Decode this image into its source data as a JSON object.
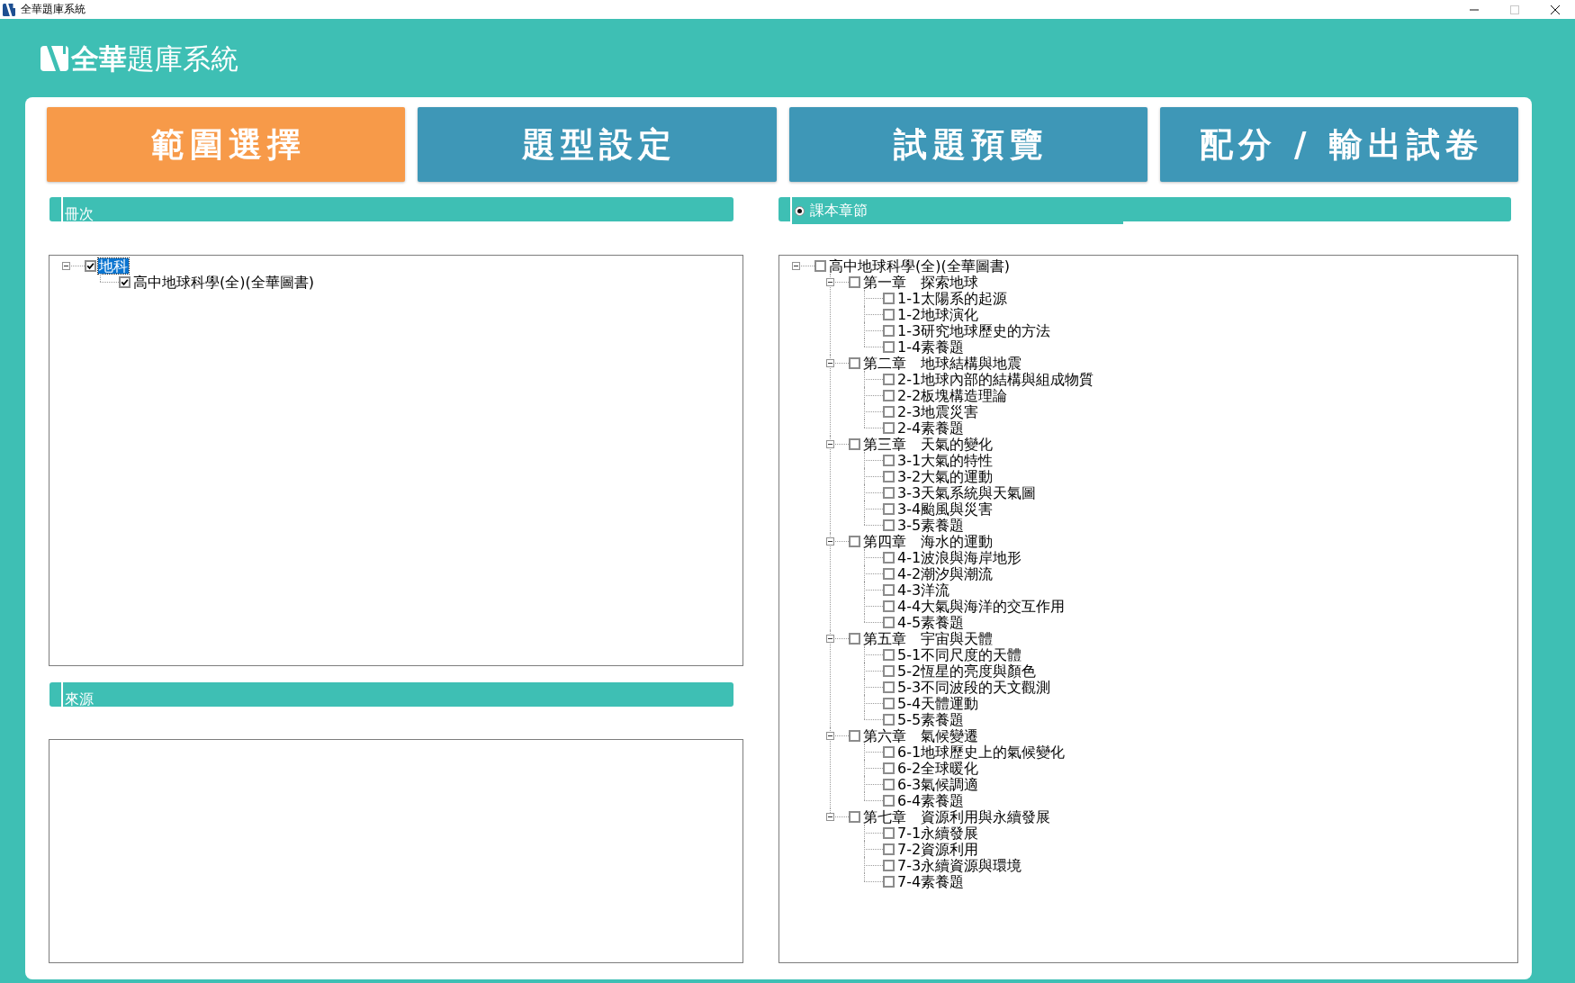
{
  "window": {
    "title": "全華題庫系統",
    "controls": [
      {
        "kind": "minimize",
        "disabled": false
      },
      {
        "kind": "maximize",
        "disabled": true
      },
      {
        "kind": "close",
        "disabled": false
      }
    ]
  },
  "header": {
    "title": "**全華**題庫系統"
  },
  "tabs": [
    {
      "label": "範圍選擇",
      "selected": true
    },
    {
      "label": "題型設定",
      "selected": false
    },
    {
      "label": "試題預覽",
      "selected": false
    },
    {
      "label": "配分 / 輸出試卷",
      "selected": false
    }
  ],
  "volume_panel": {
    "title": "冊次",
    "tree": [
      {
        "label": "地科",
        "checked": true,
        "selected": true,
        "expanded": true,
        "children": [
          {
            "label": "高中地球科學(全)(全華圖書)",
            "checked": true,
            "selected": false
          }
        ]
      }
    ]
  },
  "source_panel": {
    "title": "來源"
  },
  "chapter_panel": {
    "option": {
      "label": "課本章節",
      "selected": true
    },
    "tree": [
      {
        "label": "高中地球科學(全)(全華圖書)",
        "checked": false,
        "selected": false,
        "expanded": true,
        "children": [
          {
            "label": "第一章　探索地球",
            "checked": false,
            "selected": false,
            "expanded": true,
            "children": [
              {
                "label": "1-1太陽系的起源",
                "checked": false,
                "selected": false
              },
              {
                "label": "1-2地球演化",
                "checked": false,
                "selected": false
              },
              {
                "label": "1-3研究地球歷史的方法",
                "checked": false,
                "selected": false
              },
              {
                "label": "1-4素養題",
                "checked": false,
                "selected": false
              }
            ]
          },
          {
            "label": "第二章　地球結構與地震",
            "checked": false,
            "selected": false,
            "expanded": true,
            "children": [
              {
                "label": "2-1地球內部的結構與組成物質",
                "checked": false,
                "selected": false
              },
              {
                "label": "2-2板塊構造理論",
                "checked": false,
                "selected": false
              },
              {
                "label": "2-3地震災害",
                "checked": false,
                "selected": false
              },
              {
                "label": "2-4素養題",
                "checked": false,
                "selected": false
              }
            ]
          },
          {
            "label": "第三章　天氣的變化",
            "checked": false,
            "selected": false,
            "expanded": true,
            "children": [
              {
                "label": "3-1大氣的特性",
                "checked": false,
                "selected": false
              },
              {
                "label": "3-2大氣的運動",
                "checked": false,
                "selected": false
              },
              {
                "label": "3-3天氣系統與天氣圖",
                "checked": false,
                "selected": false
              },
              {
                "label": "3-4颱風與災害",
                "checked": false,
                "selected": false
              },
              {
                "label": "3-5素養題",
                "checked": false,
                "selected": false
              }
            ]
          },
          {
            "label": "第四章　海水的運動",
            "checked": false,
            "selected": false,
            "expanded": true,
            "children": [
              {
                "label": "4-1波浪與海岸地形",
                "checked": false,
                "selected": false
              },
              {
                "label": "4-2潮汐與潮流",
                "checked": false,
                "selected": false
              },
              {
                "label": "4-3洋流",
                "checked": false,
                "selected": false
              },
              {
                "label": "4-4大氣與海洋的交互作用",
                "checked": false,
                "selected": false
              },
              {
                "label": "4-5素養題",
                "checked": false,
                "selected": false
              }
            ]
          },
          {
            "label": "第五章　宇宙與天體",
            "checked": false,
            "selected": false,
            "expanded": true,
            "children": [
              {
                "label": "5-1不同尺度的天體",
                "checked": false,
                "selected": false
              },
              {
                "label": "5-2恆星的亮度與顏色",
                "checked": false,
                "selected": false
              },
              {
                "label": "5-3不同波段的天文觀測",
                "checked": false,
                "selected": false
              },
              {
                "label": "5-4天體運動",
                "checked": false,
                "selected": false
              },
              {
                "label": "5-5素養題",
                "checked": false,
                "selected": false
              }
            ]
          },
          {
            "label": "第六章　氣候變遷",
            "checked": false,
            "selected": false,
            "expanded": true,
            "children": [
              {
                "label": "6-1地球歷史上的氣候變化",
                "checked": false,
                "selected": false
              },
              {
                "label": "6-2全球暖化",
                "checked": false,
                "selected": false
              },
              {
                "label": "6-3氣候調適",
                "checked": false,
                "selected": false
              },
              {
                "label": "6-4素養題",
                "checked": false,
                "selected": false
              }
            ]
          },
          {
            "label": "第七章　資源利用與永續發展",
            "checked": false,
            "selected": false,
            "expanded": true,
            "children": [
              {
                "label": "7-1永續發展",
                "checked": false,
                "selected": false
              },
              {
                "label": "7-2資源利用",
                "checked": false,
                "selected": false
              },
              {
                "label": "7-3永續資源與環境",
                "checked": false,
                "selected": false
              },
              {
                "label": "7-4素養題",
                "checked": false,
                "selected": false
              }
            ]
          }
        ]
      }
    ]
  }
}
